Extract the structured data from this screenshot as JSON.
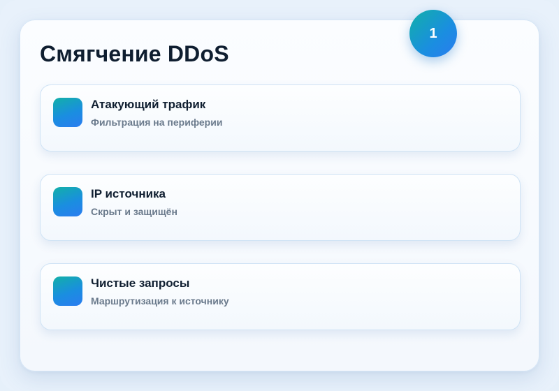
{
  "badge": {
    "number": "1"
  },
  "card": {
    "title": "Смягчение DDoS",
    "items": [
      {
        "title": "Атакующий трафик",
        "subtitle": "Фильтрация на периферии"
      },
      {
        "title": "IP источника",
        "subtitle": "Скрыт и защищён"
      },
      {
        "title": "Чистые запросы",
        "subtitle": "Маршрутизация к источнику"
      }
    ]
  },
  "colors": {
    "accent_start": "#12b0a8",
    "accent_end": "#2a7cf0",
    "title_text": "#0f1e30",
    "subtitle_text": "#6a7a8c",
    "background": "#e6f0fa"
  },
  "icons": [
    "gradient-square-icon"
  ]
}
